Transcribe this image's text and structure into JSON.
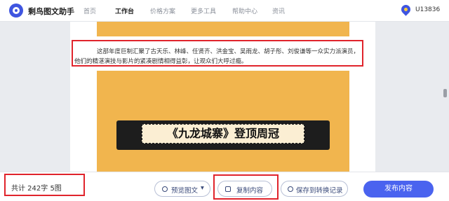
{
  "app": {
    "name": "剩鸟图文助手",
    "user": "U13836"
  },
  "nav": {
    "items": [
      "首页",
      "工作台",
      "价格方案",
      "更多工具",
      "帮助中心",
      "资讯"
    ],
    "active_index": 1
  },
  "article": {
    "paragraph": "这部年度巨制汇聚了古天乐、林峰、任贤齐、洪金宝、吴雨龙、胡子彤、刘俊谦等一众实力派演员，他们的精湛演技与影片的紧凑剧情相得益彰，让观众们大呼过瘾。",
    "image_title": "《九龙城寨》登顶周冠"
  },
  "footer": {
    "word_count": "共计 242字 5图",
    "preview_label": "预览图文",
    "preview_dropdown": "▾",
    "copy_label": "复制内容",
    "save_label": "保存到转换记录",
    "publish_label": "发布内容"
  },
  "icons": [
    "logo-icon",
    "location-icon",
    "eye-icon",
    "copy-icon",
    "save-icon"
  ],
  "colors": {
    "accent": "#4a63ef",
    "highlight": "#e0242c",
    "image_bg": "#f1b54e"
  }
}
